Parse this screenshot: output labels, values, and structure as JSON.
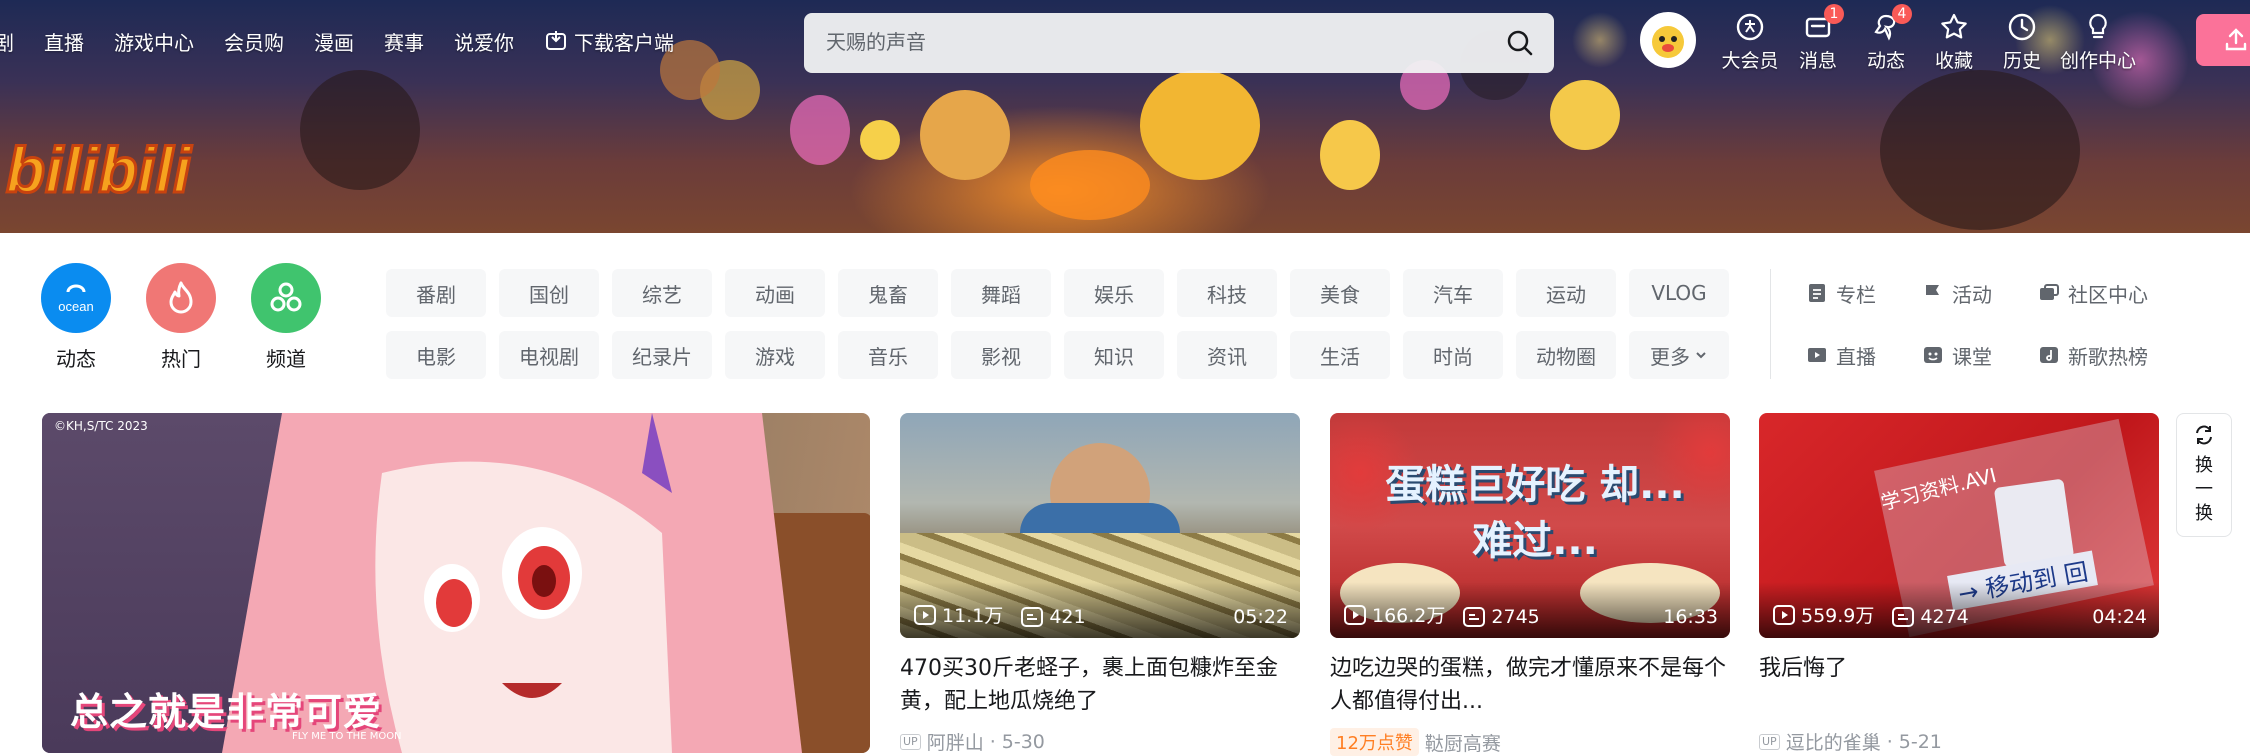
{
  "nav": {
    "left_items": [
      "剧",
      "直播",
      "游戏中心",
      "会员购",
      "漫画",
      "赛事",
      "说爱你"
    ],
    "download_label": "下载客户端"
  },
  "search": {
    "placeholder": "天赐的声音"
  },
  "logo_text": "bilibili",
  "tools": [
    {
      "label": "大会员",
      "icon": "vip-icon",
      "badge": ""
    },
    {
      "label": "消息",
      "icon": "message-icon",
      "badge": "1"
    },
    {
      "label": "动态",
      "icon": "dynamic-icon",
      "badge": "4"
    },
    {
      "label": "收藏",
      "icon": "star-icon",
      "badge": ""
    },
    {
      "label": "历史",
      "icon": "clock-icon",
      "badge": ""
    },
    {
      "label": "创作中心",
      "icon": "bulb-icon",
      "badge": ""
    }
  ],
  "quick": [
    {
      "label": "动态",
      "color": "#0a8cf0",
      "icon_text": "ocean"
    },
    {
      "label": "热门",
      "color": "#f07775",
      "icon_text": ""
    },
    {
      "label": "频道",
      "color": "#40c46e",
      "icon_text": ""
    }
  ],
  "categories": [
    "番剧",
    "国创",
    "综艺",
    "动画",
    "鬼畜",
    "舞蹈",
    "娱乐",
    "科技",
    "美食",
    "汽车",
    "运动",
    "VLOG",
    "电影",
    "电视剧",
    "纪录片",
    "游戏",
    "音乐",
    "影视",
    "知识",
    "资讯",
    "生活",
    "时尚",
    "动物圈",
    "更多"
  ],
  "side_links": [
    {
      "label": "专栏",
      "icon": "column-icon"
    },
    {
      "label": "活动",
      "icon": "flag-icon"
    },
    {
      "label": "社区中心",
      "icon": "community-icon"
    },
    {
      "label": "直播",
      "icon": "live-icon"
    },
    {
      "label": "课堂",
      "icon": "classroom-icon"
    },
    {
      "label": "新歌热榜",
      "icon": "music-icon"
    }
  ],
  "featured": {
    "copyright": "©KH,S/TC 2023",
    "caption": "总之就是非常可爱",
    "sub": "FLY ME TO THE MOON"
  },
  "videos": [
    {
      "views": "11.1万",
      "danmaku": "421",
      "duration": "05:22",
      "title": "470买30斤老蛏子，裹上面包糠炸至金黄，配上地瓜烧绝了",
      "hot": "",
      "author": "阿胖山",
      "date": "5-30"
    },
    {
      "views": "166.2万",
      "danmaku": "2745",
      "duration": "16:33",
      "title": "边吃边哭的蛋糕，做完才懂原来不是每个人都值得付出...",
      "hot": "12万点赞",
      "author": "鞑厨高赛",
      "date": "",
      "thumb_text": "蛋糕巨好吃 却...难过..."
    },
    {
      "views": "559.9万",
      "danmaku": "4274",
      "duration": "04:24",
      "title": "我后悔了",
      "hot": "",
      "author": "逗比的雀巢",
      "date": "5-21",
      "thumb_text_a": "学习资料.AVI",
      "thumb_text_b": "→ 移动到 回"
    }
  ],
  "swap_label": [
    "换",
    "一",
    "换"
  ]
}
